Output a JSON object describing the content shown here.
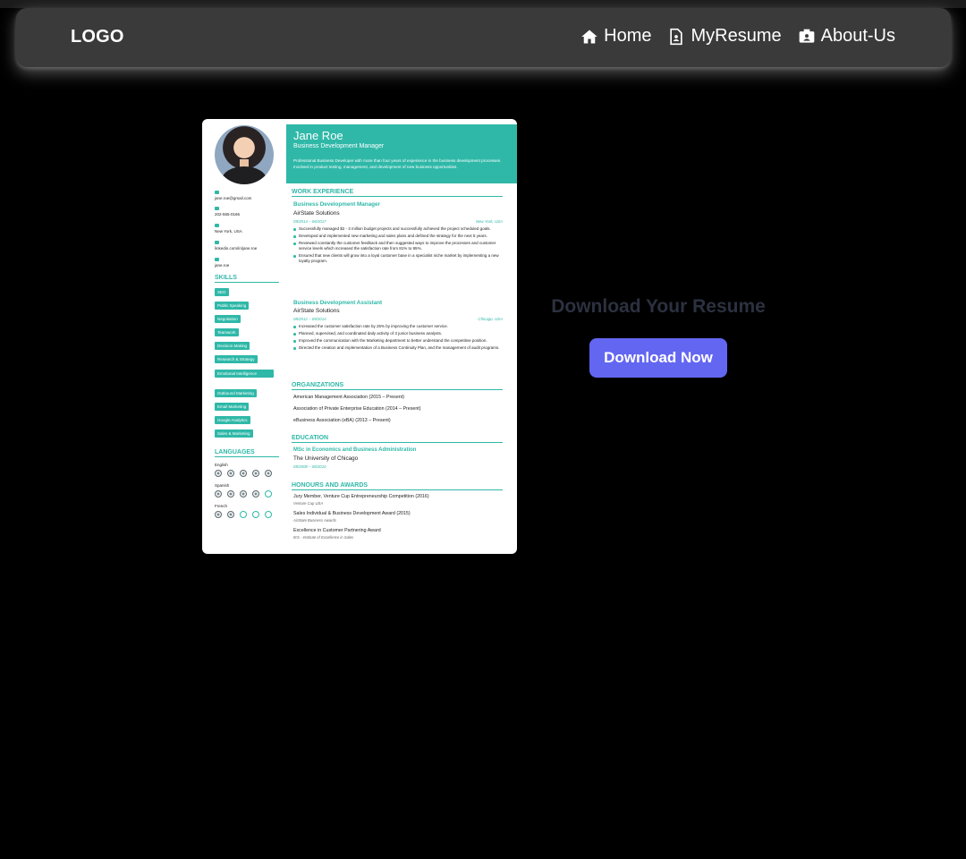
{
  "navbar": {
    "logo": "LOGO",
    "items": [
      {
        "label": "Home",
        "icon": "home-icon"
      },
      {
        "label": "MyResume",
        "icon": "document-icon"
      },
      {
        "label": "About-Us",
        "icon": "contact-card-icon"
      }
    ]
  },
  "resume": {
    "name": "Jane Roe",
    "title": "Business Development Manager",
    "summary": "Professional Business Developer with more than four years of experience in the business development processes. Involved in product testing, management, and development of new business opportunities.",
    "accent_color": "#2fb8a8",
    "contacts": [
      "jane.roe@gmail.com",
      "202-555-0166",
      "New York, USA",
      "linkedin.com/in/jane.roe",
      "jane.roe"
    ],
    "skills_heading": "SKILLS",
    "skills": [
      "SEO",
      "Public Speaking",
      "Negotiation",
      "Teamwork",
      "Decision Making",
      "Research & Strategy",
      "Emotional Intelligence",
      "Outbound Marketing",
      "Email Marketing",
      "Google Analytics",
      "Sales & Marketing"
    ],
    "languages_heading": "LANGUAGES",
    "languages": [
      {
        "name": "English",
        "level": 5
      },
      {
        "name": "Spanish",
        "level": 4
      },
      {
        "name": "French",
        "level": 2
      }
    ],
    "work_heading": "WORK EXPERIENCE",
    "jobs": [
      {
        "title": "Business Development Manager",
        "company": "AirState Solutions",
        "dates": "09/2014 – 06/2017",
        "location": "New York, USA",
        "bullets": [
          "Successfully managed $2 - 3 million budget projects and successfully achieved the project scheduled goals.",
          "Developed and implemented new marketing and sales plans and defined the strategy for the next 5 years.",
          "Reviewed constantly the customer feedback and then suggested ways to improve the processes and customer service levels which increased the satisfaction rate from 81% to 95%.",
          "Ensured that new clients will grow into a loyal customer base in a specialist niche market by implementing a new loyalty program."
        ]
      },
      {
        "title": "Business Development Assistant",
        "company": "AirState Solutions",
        "dates": "08/2012 – 09/2014",
        "location": "Chicago, USA",
        "bullets": [
          "Increased the customer satisfaction rate by 25% by improving the customer service.",
          "Planned, supervised, and coordinated daily activity of 3 junior business analysts.",
          "Improved the communication with the Marketing department to better understand the competitive position.",
          "Directed the creation and implementation of a Business Continuity Plan, and the management of audit programs."
        ]
      }
    ],
    "org_heading": "ORGANIZATIONS",
    "organizations": [
      "American Management Association (2015 – Present)",
      "Association of Private Enterprise Education (2014 – Present)",
      "eBusiness Association (eBA) (2013 – Present)"
    ],
    "edu_heading": "EDUCATION",
    "education": {
      "degree": "MSc in Economics and Business Administration",
      "school": "The University of Chicago",
      "dates": "09/2008 – 06/2010"
    },
    "awards_heading": "HONOURS AND AWARDS",
    "awards": [
      {
        "title": "Jury Member, Venture Cup Entrepreneurship Competition (2016)",
        "sub": "Venture Cup USA"
      },
      {
        "title": "Sales Individual & Business Development Award (2015)",
        "sub": "AirState Business Awards"
      },
      {
        "title": "Excellence in Customer Partnering Award",
        "sub": "IES - Institute of Excellence in Sales"
      }
    ]
  },
  "download": {
    "heading": "Download Your Resume",
    "button_label": "Download Now",
    "button_color": "#6366f1"
  }
}
